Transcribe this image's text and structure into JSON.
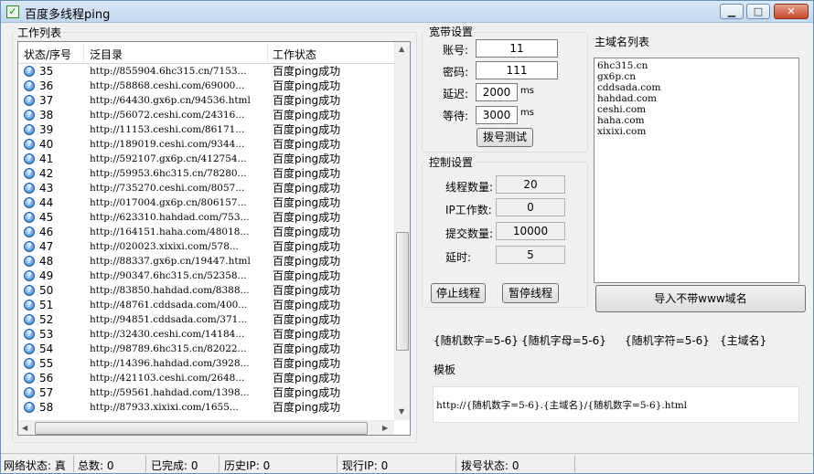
{
  "window": {
    "title": "百度多线程ping",
    "minimize": "▁",
    "maximize": "□",
    "close": "✕"
  },
  "worklist": {
    "label": "工作列表",
    "headers": [
      "状态/序号",
      "泛目录",
      "工作状态"
    ],
    "rows": [
      {
        "id": "35",
        "url": "http://855904.6hc315.cn/7153...",
        "status": "百度ping成功"
      },
      {
        "id": "36",
        "url": "http://58868.ceshi.com/69000...",
        "status": "百度ping成功"
      },
      {
        "id": "37",
        "url": "http://64430.gx6p.cn/94536.html",
        "status": "百度ping成功"
      },
      {
        "id": "38",
        "url": "http://56072.ceshi.com/24316...",
        "status": "百度ping成功"
      },
      {
        "id": "39",
        "url": "http://11153.ceshi.com/86171...",
        "status": "百度ping成功"
      },
      {
        "id": "40",
        "url": "http://189019.ceshi.com/9344...",
        "status": "百度ping成功"
      },
      {
        "id": "41",
        "url": "http://592107.gx6p.cn/412754...",
        "status": "百度ping成功"
      },
      {
        "id": "42",
        "url": "http://59953.6hc315.cn/78280...",
        "status": "百度ping成功"
      },
      {
        "id": "43",
        "url": "http://735270.ceshi.com/8057...",
        "status": "百度ping成功"
      },
      {
        "id": "44",
        "url": "http://017004.gx6p.cn/806157...",
        "status": "百度ping成功"
      },
      {
        "id": "45",
        "url": "http://623310.hahdad.com/753...",
        "status": "百度ping成功"
      },
      {
        "id": "46",
        "url": "http://164151.haha.com/48018...",
        "status": "百度ping成功"
      },
      {
        "id": "47",
        "url": "http://020023.xixixi.com/578...",
        "status": "百度ping成功"
      },
      {
        "id": "48",
        "url": "http://88337.gx6p.cn/19447.html",
        "status": "百度ping成功"
      },
      {
        "id": "49",
        "url": "http://90347.6hc315.cn/52358...",
        "status": "百度ping成功"
      },
      {
        "id": "50",
        "url": "http://83850.hahdad.com/8388...",
        "status": "百度ping成功"
      },
      {
        "id": "51",
        "url": "http://48761.cddsada.com/400...",
        "status": "百度ping成功"
      },
      {
        "id": "52",
        "url": "http://94851.cddsada.com/371...",
        "status": "百度ping成功"
      },
      {
        "id": "53",
        "url": "http://32430.ceshi.com/14184...",
        "status": "百度ping成功"
      },
      {
        "id": "54",
        "url": "http://98789.6hc315.cn/82022...",
        "status": "百度ping成功"
      },
      {
        "id": "55",
        "url": "http://14396.hahdad.com/3928...",
        "status": "百度ping成功"
      },
      {
        "id": "56",
        "url": "http://421103.ceshi.com/2648...",
        "status": "百度ping成功"
      },
      {
        "id": "57",
        "url": "http://59561.hahdad.com/1398...",
        "status": "百度ping成功"
      },
      {
        "id": "58",
        "url": "http://87933.xixixi.com/1655...",
        "status": "百度ping成功"
      }
    ]
  },
  "broadband": {
    "label": "宽带设置",
    "account_label": "账号:",
    "account": "11",
    "password_label": "密码:",
    "password": "111",
    "delay_label": "延迟:",
    "delay": "2000",
    "delay_unit": "ms",
    "wait_label": "等待:",
    "wait": "3000",
    "wait_unit": "ms",
    "dial_test": "拨号测试"
  },
  "control": {
    "label": "控制设置",
    "threads_label": "线程数量:",
    "threads": "20",
    "ip_label": "IP工作数:",
    "ip": "0",
    "submit_label": "提交数量:",
    "submit": "10000",
    "delay_label": "延时:",
    "delay": "5",
    "stop": "停止线程",
    "pause": "暂停线程"
  },
  "domains": {
    "label": "主域名列表",
    "items": [
      "6hc315.cn",
      "gx6p.cn",
      "cddsada.com",
      "hahdad.com",
      "ceshi.com",
      "haha.com",
      "xixixi.com"
    ],
    "import_button": "导入不带www域名"
  },
  "tags": [
    "{随机数字=5-6}",
    "{随机字母=5-6}",
    "{随机字符=5-6}",
    "{主域名}"
  ],
  "template": {
    "label": "模板",
    "value": "http://{随机数字=5-6}.{主域名}/{随机数字=5-6}.html"
  },
  "statusbar": [
    "网络状态: 真",
    "总数: 0",
    "已完成: 0",
    "历史IP: 0",
    "现行IP: 0",
    "拨号状态: 0"
  ]
}
